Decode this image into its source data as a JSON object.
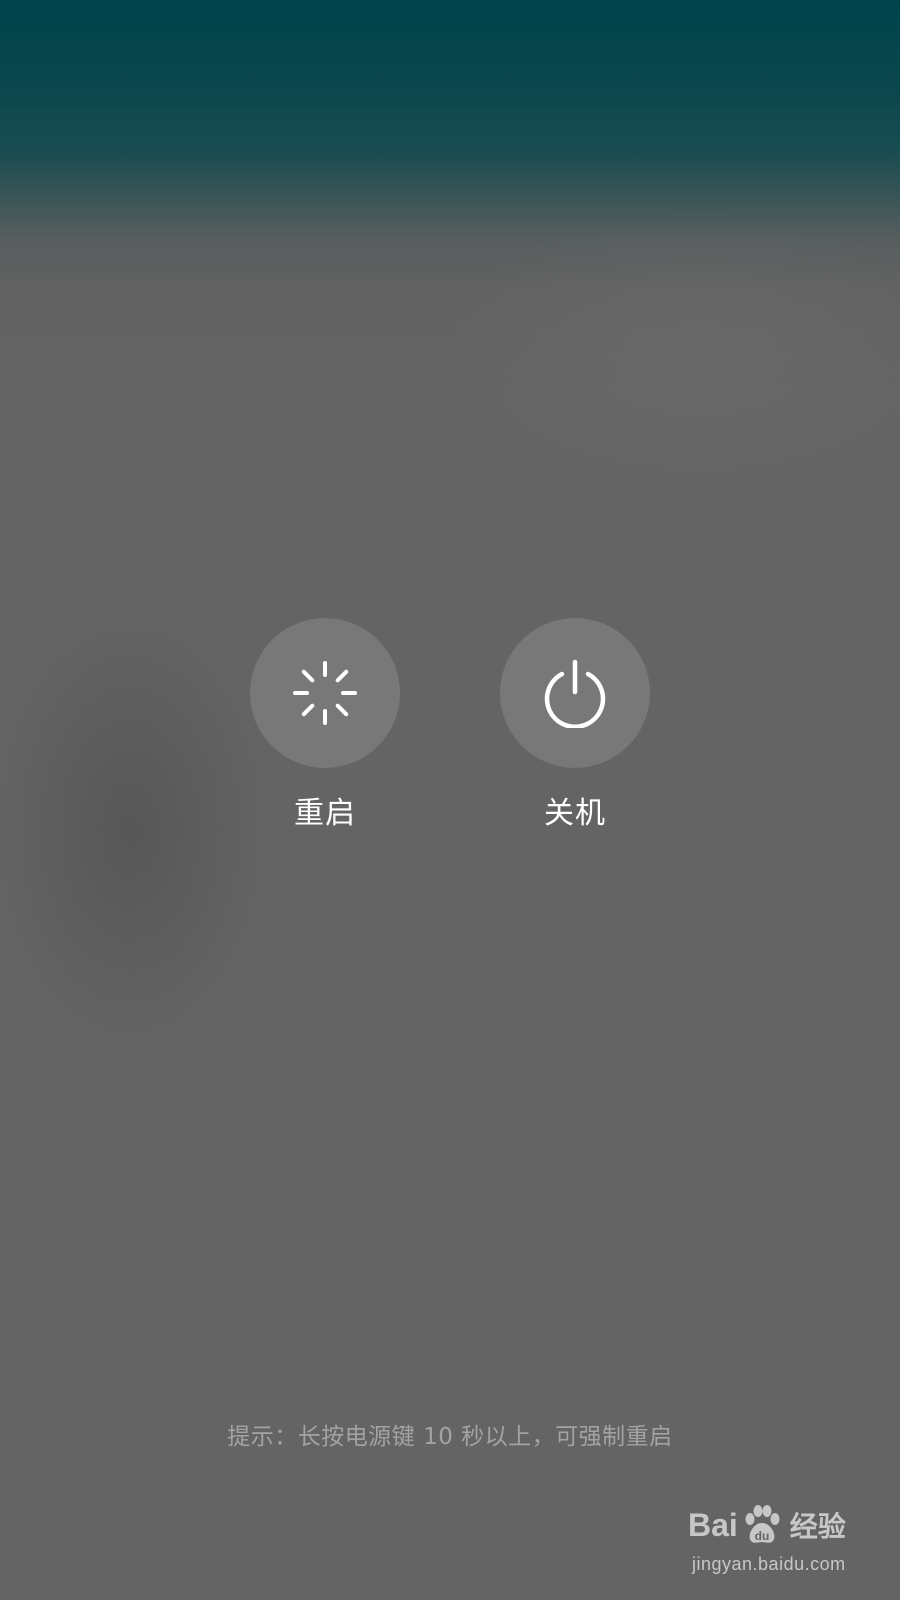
{
  "power_menu": {
    "restart": {
      "label": "重启",
      "icon": "restart-spinner-icon"
    },
    "shutdown": {
      "label": "关机",
      "icon": "power-icon"
    }
  },
  "hint": "提示：长按电源键 10 秒以上，可强制重启",
  "watermark": {
    "logo_text_left": "Bai",
    "logo_text_right": "经验",
    "url": "jingyan.baidu.com",
    "icon": "baidu-paw-icon"
  },
  "colors": {
    "top_teal": "#00444b",
    "background_gray": "#646464",
    "button_circle": "#787878",
    "label_white": "#ffffff",
    "hint_gray": "#a3a3a3"
  }
}
